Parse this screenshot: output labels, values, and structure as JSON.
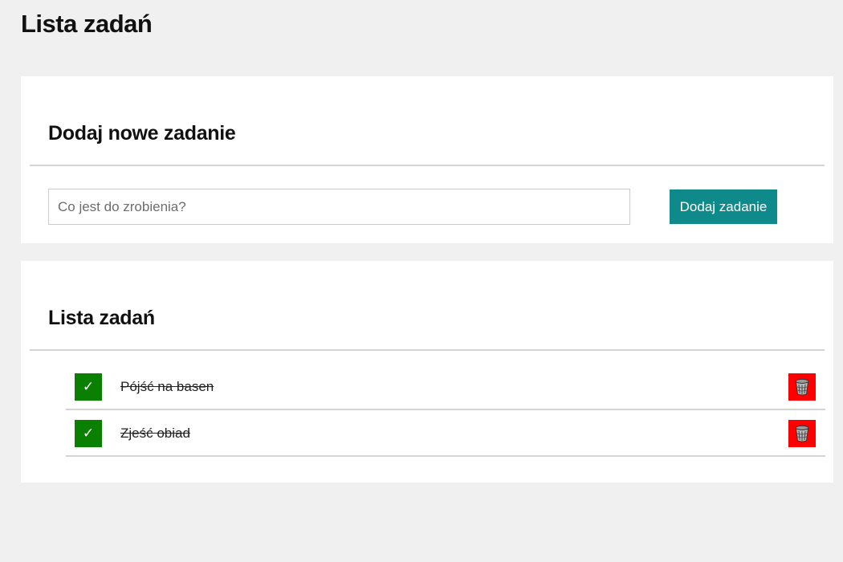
{
  "header": {
    "title": "Lista zadań"
  },
  "add_section": {
    "title": "Dodaj nowe zadanie",
    "input_placeholder": "Co jest do zrobienia?",
    "input_value": "",
    "button_label": "Dodaj zadanie"
  },
  "list_section": {
    "title": "Lista zadań",
    "tasks": [
      {
        "text": "Pójść na basen",
        "done": true,
        "check_symbol": "✓"
      },
      {
        "text": "Zjeść obiad",
        "done": true,
        "check_symbol": "✓"
      }
    ]
  },
  "colors": {
    "page_background": "#f0f0f0",
    "accent_button": "#0f8a8a",
    "done_check": "#0a8000",
    "delete": "#ff0000"
  }
}
